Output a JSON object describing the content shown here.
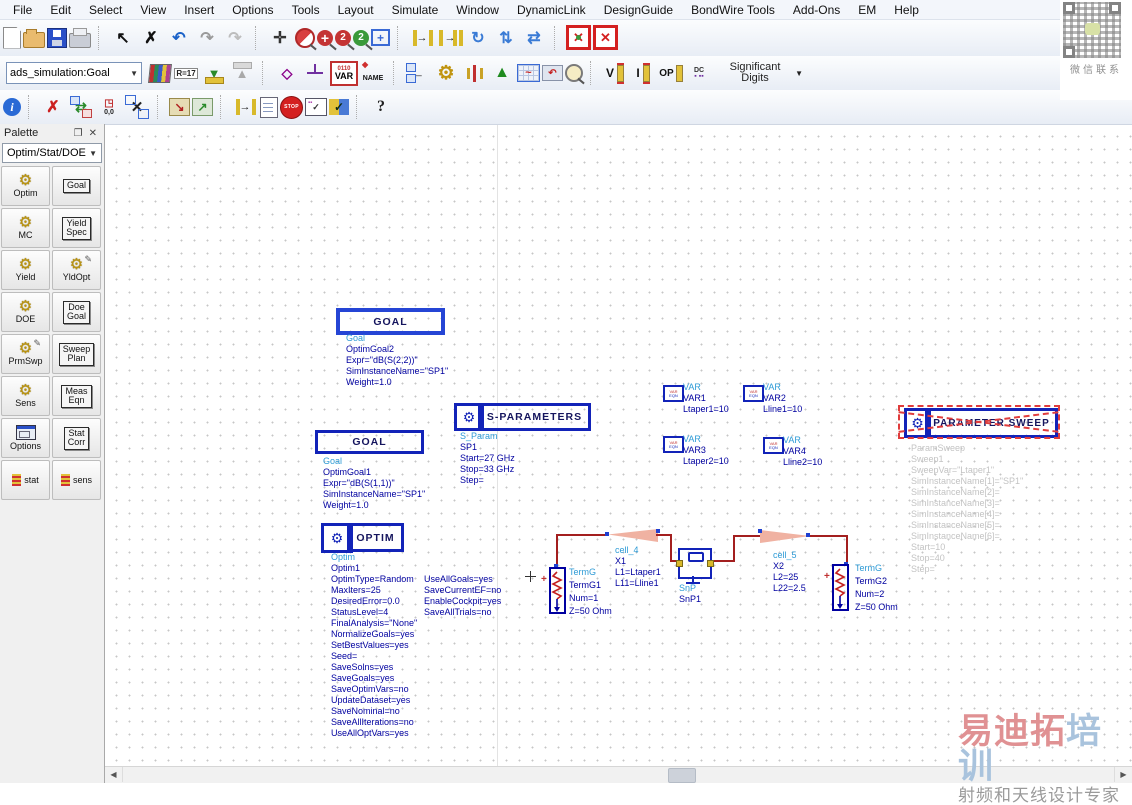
{
  "menu": {
    "items": [
      "File",
      "Edit",
      "Select",
      "View",
      "Insert",
      "Options",
      "Tools",
      "Layout",
      "Simulate",
      "Window",
      "DynamicLink",
      "DesignGuide",
      "BondWire Tools",
      "Add-Ons",
      "EM",
      "Help"
    ]
  },
  "toolbar_row1": {
    "icons": [
      {
        "name": "new-design-icon",
        "cls": "ic-page"
      },
      {
        "name": "open-design-icon",
        "cls": "ic-folder"
      },
      {
        "name": "save-design-icon",
        "cls": "ic-save"
      },
      {
        "name": "print-icon",
        "cls": "ic-print"
      },
      {
        "sep": true
      },
      {
        "name": "select-cursor-icon",
        "glyph": "↖",
        "color": "#111"
      },
      {
        "name": "delete-icon",
        "glyph": "✗",
        "color": "#111"
      },
      {
        "name": "undo-icon",
        "glyph": "↶",
        "color": "#1b62c8"
      },
      {
        "name": "redo-icon",
        "glyph": "↷",
        "color": "#9a9a9a"
      },
      {
        "name": "undo-history-icon",
        "glyph": "↷",
        "color": "#bdbdbd"
      },
      {
        "sep": true
      },
      {
        "name": "pan-view-icon",
        "glyph": "✛",
        "color": "#333"
      },
      {
        "name": "zoom-area-icon",
        "cls": "ic-zoomarea"
      },
      {
        "name": "zoom-in-icon",
        "cls": "ic-zoomin",
        "glyph": "+",
        "color": "#fff"
      },
      {
        "name": "zoom-in-2x-icon",
        "cls": "ic-zoom2red",
        "txt": "2"
      },
      {
        "name": "zoom-out-2x-icon",
        "cls": "ic-zoom2green",
        "txt": "2"
      },
      {
        "name": "zoom-selection-icon",
        "cls": "ic-zoomwin",
        "glyph": "+"
      },
      {
        "sep": true
      },
      {
        "name": "insert-wire-icon",
        "cls": "ic-pins",
        "glyph": "→",
        "color": "#222"
      },
      {
        "name": "insert-multi-wire-icon",
        "cls": "ic-pins2",
        "glyph": "→",
        "color": "#222"
      },
      {
        "name": "rotate-component-icon",
        "glyph": "↻",
        "color": "#3a7bd5"
      },
      {
        "name": "mirror-vertical-icon",
        "glyph": "⇅",
        "color": "#3a7bd5"
      },
      {
        "name": "mirror-horizontal-icon",
        "glyph": "⇄",
        "color": "#3a7bd5"
      },
      {
        "sep": true
      },
      {
        "name": "deactivate-component-icon",
        "cls": "ic-redx",
        "glyph": "✕"
      },
      {
        "name": "deactivate-short-component-icon",
        "cls": "ic-redx2",
        "glyph": "✕"
      }
    ]
  },
  "toolbar_row2": {
    "combo": "ads_simulation:Goal",
    "sig_digits": "Significant Digits",
    "icons": [
      {
        "name": "library-browser-icon",
        "cls": "ic-books"
      },
      {
        "name": "component-parameter-icon",
        "cls": "ic-r17",
        "txt": "R=17"
      },
      {
        "name": "insert-component-icon",
        "cls": "ic-downgold",
        "glyph": "▼"
      },
      {
        "name": "export-component-icon",
        "cls": "ic-upgray",
        "glyph": "▲"
      },
      {
        "sep": true
      },
      {
        "name": "insert-port-icon",
        "cls": "ic-port",
        "glyph": "◇"
      },
      {
        "name": "insert-ground-icon",
        "cls": "ic-gnd"
      },
      {
        "name": "insert-var-icon",
        "cls": "ic-var",
        "glyph": "0110",
        "txt": "VAR"
      },
      {
        "name": "wire-name-icon",
        "cls": "ic-name",
        "txt": "NAME"
      },
      {
        "sep": true
      },
      {
        "name": "netlist-include-icon",
        "cls": "ic-hier",
        "glyph": "←"
      },
      {
        "name": "simulation-settings-icon",
        "cls": "ic-gear",
        "glyph": "⚙"
      },
      {
        "name": "tune-parameters-icon",
        "cls": "ic-tune"
      },
      {
        "name": "optimize-icon",
        "cls": "ic-optup",
        "glyph": "▲"
      },
      {
        "name": "simulate-display-icon",
        "cls": "ic-wave",
        "glyph": "~",
        "color": "#c42020"
      },
      {
        "name": "data-display-icon",
        "cls": "ic-disp",
        "glyph": "↶"
      },
      {
        "name": "search-icon",
        "cls": "ic-mag"
      },
      {
        "sep": true
      },
      {
        "name": "voltage-probe-icon",
        "cls": "ic-vpin",
        "glyph": "V",
        "color": "#111"
      },
      {
        "name": "current-probe-icon",
        "cls": "ic-vpin",
        "glyph": "I",
        "color": "#111"
      },
      {
        "name": "op-probe-icon",
        "cls": "ic-op",
        "glyph": "OP",
        "color": "#111"
      },
      {
        "name": "dc-annotation-icon",
        "cls": "ic-dc",
        "txt": "DC"
      }
    ]
  },
  "toolbar_row3": {
    "icons": [
      {
        "name": "info-icon",
        "cls": "ic-info",
        "glyph": "i",
        "color": "#fff"
      },
      {
        "sep": true
      },
      {
        "name": "deactivate-part-icon",
        "glyph": "✗",
        "color": "#cc2020"
      },
      {
        "name": "swap-component-icon",
        "cls": "ic-swap",
        "glyph": "⇄"
      },
      {
        "name": "set-origin-icon",
        "cls": "ic-origin",
        "txt": "0,0"
      },
      {
        "name": "clear-selection-icon",
        "cls": "ic-selx",
        "glyph": "✕",
        "color": "#222"
      },
      {
        "sep": true
      },
      {
        "name": "push-into-hierarchy-icon",
        "cls": "ic-push",
        "glyph": "↘"
      },
      {
        "name": "pop-out-hierarchy-icon",
        "cls": "ic-pop",
        "glyph": "↗"
      },
      {
        "sep": true
      },
      {
        "name": "wire-pin-icon",
        "cls": "ic-pins",
        "glyph": "→",
        "color": "#222"
      },
      {
        "name": "netlist-viewer-icon",
        "cls": "ic-doc"
      },
      {
        "name": "stop-simulation-icon",
        "cls": "ic-stopsign",
        "txt": "STOP"
      },
      {
        "name": "simulation-status-icon",
        "cls": "ic-simdlg",
        "glyph": "✓"
      },
      {
        "name": "design-check-icon",
        "cls": "ic-check",
        "glyph": "✓"
      },
      {
        "sep": true
      },
      {
        "name": "help-icon",
        "cls": "ic-help",
        "glyph": "?",
        "color": "#222"
      }
    ]
  },
  "qr": {
    "caption": "微信联系"
  },
  "palette": {
    "title": "Palette",
    "category": "Optim/Stat/DOE",
    "items": [
      {
        "label": "Optim",
        "kind": "gear"
      },
      {
        "label": "Goal",
        "kind": "box",
        "box_lines": [
          "Goal"
        ]
      },
      {
        "label": "MC",
        "kind": "gear"
      },
      {
        "label": "Yield Spec",
        "kind": "box",
        "box_lines": [
          "Yield",
          "Spec"
        ]
      },
      {
        "label": "Yield",
        "kind": "gear"
      },
      {
        "label": "YldOpt",
        "kind": "gearpen"
      },
      {
        "label": "DOE",
        "kind": "gear"
      },
      {
        "label": "Doe Goal",
        "kind": "box",
        "box_lines": [
          "Doe",
          "Goal"
        ]
      },
      {
        "label": "PrmSwp",
        "kind": "gearpen"
      },
      {
        "label": "Sweep Plan",
        "kind": "box",
        "box_lines": [
          "Sweep",
          "Plan"
        ]
      },
      {
        "label": "Sens",
        "kind": "gear"
      },
      {
        "label": "Meas Eqn",
        "kind": "box",
        "box_lines": [
          "Meas",
          "Eqn"
        ]
      },
      {
        "label": "Options",
        "kind": "window"
      },
      {
        "label": "Stat Corr",
        "kind": "box",
        "box_lines": [
          "Stat",
          "Corr"
        ]
      },
      {
        "label": "stat",
        "kind": "hist"
      },
      {
        "label": "sens",
        "kind": "hist"
      }
    ]
  },
  "canvas": {
    "goal1": {
      "title": "GOAL",
      "lines": [
        "Goal",
        "OptimGoal2",
        "Expr=\"dB(S(2,2))\"",
        "SimInstanceName=\"SP1\"",
        "Weight=1.0"
      ]
    },
    "goal2": {
      "title": "GOAL",
      "lines": [
        "Goal",
        "OptimGoal1",
        "Expr=\"dB(S(1,1))\"",
        "SimInstanceName=\"SP1\"",
        "Weight=1.0"
      ]
    },
    "sparams": {
      "title": "S-PARAMETERS",
      "lines": [
        "S_Param",
        "SP1",
        "Start=27 GHz",
        "Stop=33 GHz",
        "Step="
      ]
    },
    "vars": [
      {
        "label": "VAR",
        "inst": "VAR1",
        "param": "Ltaper1=10"
      },
      {
        "label": "VAR",
        "inst": "VAR2",
        "param": "Lline1=10"
      },
      {
        "label": "VAR",
        "inst": "VAR3",
        "param": "Ltaper2=10"
      },
      {
        "label": "VAR",
        "inst": "VAR4",
        "param": "Lline2=10"
      }
    ],
    "psweep": {
      "title": "PARAMETER SWEEP",
      "lines": [
        "ParamSweep",
        "Sweep1",
        "SweepVar=\"Ltaper1\"",
        "SimInstanceName[1]=\"SP1\"",
        "SimInstanceName[2]=",
        "SimInstanceName[3]=",
        "SimInstanceName[4]=",
        "SimInstanceName[5]=",
        "SimInstanceName[6]=",
        "Start=10",
        "Stop=40",
        "Step="
      ]
    },
    "optim": {
      "title": "OPTIM",
      "head": [
        "Optim",
        "Optim1"
      ],
      "col1": [
        "OptimType=Random",
        "MaxIters=25",
        "DesiredError=0.0",
        "StatusLevel=4",
        "FinalAnalysis=\"None\"",
        "NormalizeGoals=yes",
        "SetBestValues=yes",
        "Seed=",
        "SaveSolns=yes",
        "SaveGoals=yes",
        "SaveOptimVars=no",
        "UpdateDataset=yes",
        "SaveNominal=no",
        "SaveAllIterations=no",
        "UseAllOptVars=yes"
      ],
      "col2": [
        "UseAllGoals=yes",
        "SaveCurrentEF=no",
        "EnableCockpit=yes",
        "SaveAllTrials=no"
      ]
    },
    "term1": {
      "lines": [
        "TermG",
        "TermG1",
        "Num=1",
        "Z=50 Ohm"
      ]
    },
    "term2": {
      "lines": [
        "TermG",
        "TermG2",
        "Num=2",
        "Z=50 Ohm"
      ]
    },
    "cell4": {
      "lines": [
        "cell_4",
        "X1",
        "L1=Ltaper1",
        "L11=Lline1"
      ]
    },
    "cell5": {
      "lines": [
        "cell_5",
        "X2",
        "L2=25",
        "L22=2.5"
      ]
    },
    "snp": {
      "lines": [
        "SnP",
        "SnP1"
      ]
    }
  },
  "watermark": {
    "brand_red": "易迪拓",
    "brand_blue": "培训",
    "tagline": "射频和天线设计专家"
  },
  "scrollbar": {
    "left_arrow": "◀",
    "right_arrow": "▶"
  },
  "palette_header_icons": {
    "float": "❐",
    "close": "✕"
  },
  "colors": {
    "wire": "#a31f1f",
    "component_text": "#0000a0",
    "instance_text": "#2e9bd6",
    "selection": "#2545d5",
    "deactivated_text": "#c3c3c3",
    "deactivate_marker": "#e03c3c"
  }
}
